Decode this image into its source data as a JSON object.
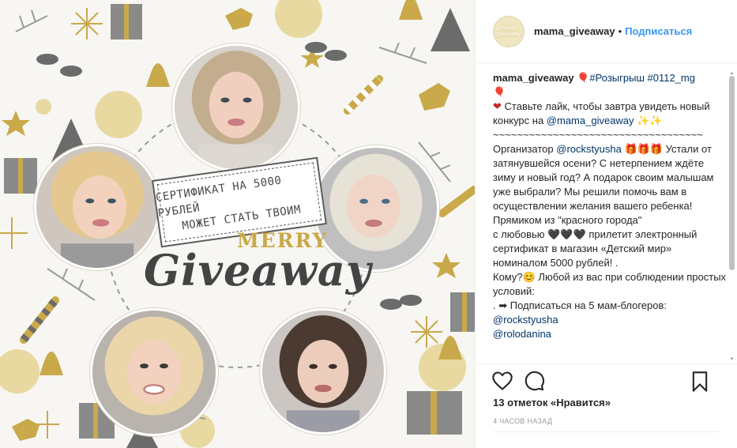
{
  "image": {
    "cert_line1": "Сертификат на 5000 рублей",
    "cert_line2": "может стать твоим",
    "merry": "MERRY",
    "giveaway": "Giveaway"
  },
  "header": {
    "avatar_text": "mama giveaway",
    "username": "mama_giveaway",
    "dot": "•",
    "follow": "Подписаться"
  },
  "caption": {
    "username": "mama_giveaway",
    "line1_rest": " 🎈#Розыгрыш #0112_mg",
    "line2_balloon": "🎈",
    "line3_heart": "❤",
    "line3": " Ставьте лайк, чтобы завтра увидеть новый конкурс на ",
    "line3_mention": "@mama_giveaway",
    "line3_end": " ✨✨",
    "tilde": "~~~~~~~~~~~~~~~~~~~~~~~~~~~~~~~~~~~",
    "org_label": "Организатор ",
    "org_mention": "@rockstyusha",
    "org_text": " 🎁🎁🎁 Устали от затянувшейся осени? С нетерпением ждёте зиму и новый год? А подарок своим малышам уже выбрали? Мы решили помочь вам в осуществлении желания вашего ребенка! Прямиком из \"красного города\"",
    "love_line": "с любовью 🖤🖤🖤 прилетит электронный сертификат в магазин «Детский мир» номиналом 5000 рублей! .",
    "who": "Кому?😊 Любой из вас при соблюдении простых условий:",
    "step1": ". ➡ Подписаться на 5 мам-блогеров:",
    "step1_mention": "@rockstyusha",
    "cut_mention": "@rolodanina"
  },
  "actions": {
    "likes": "13 отметок «Нравится»",
    "time": "4 ЧАСОВ НАЗАД"
  },
  "colors": {
    "accent_blue": "#3897f0",
    "link_navy": "#003569",
    "gold": "#c9a94a",
    "grey": "#6b6b6b"
  }
}
